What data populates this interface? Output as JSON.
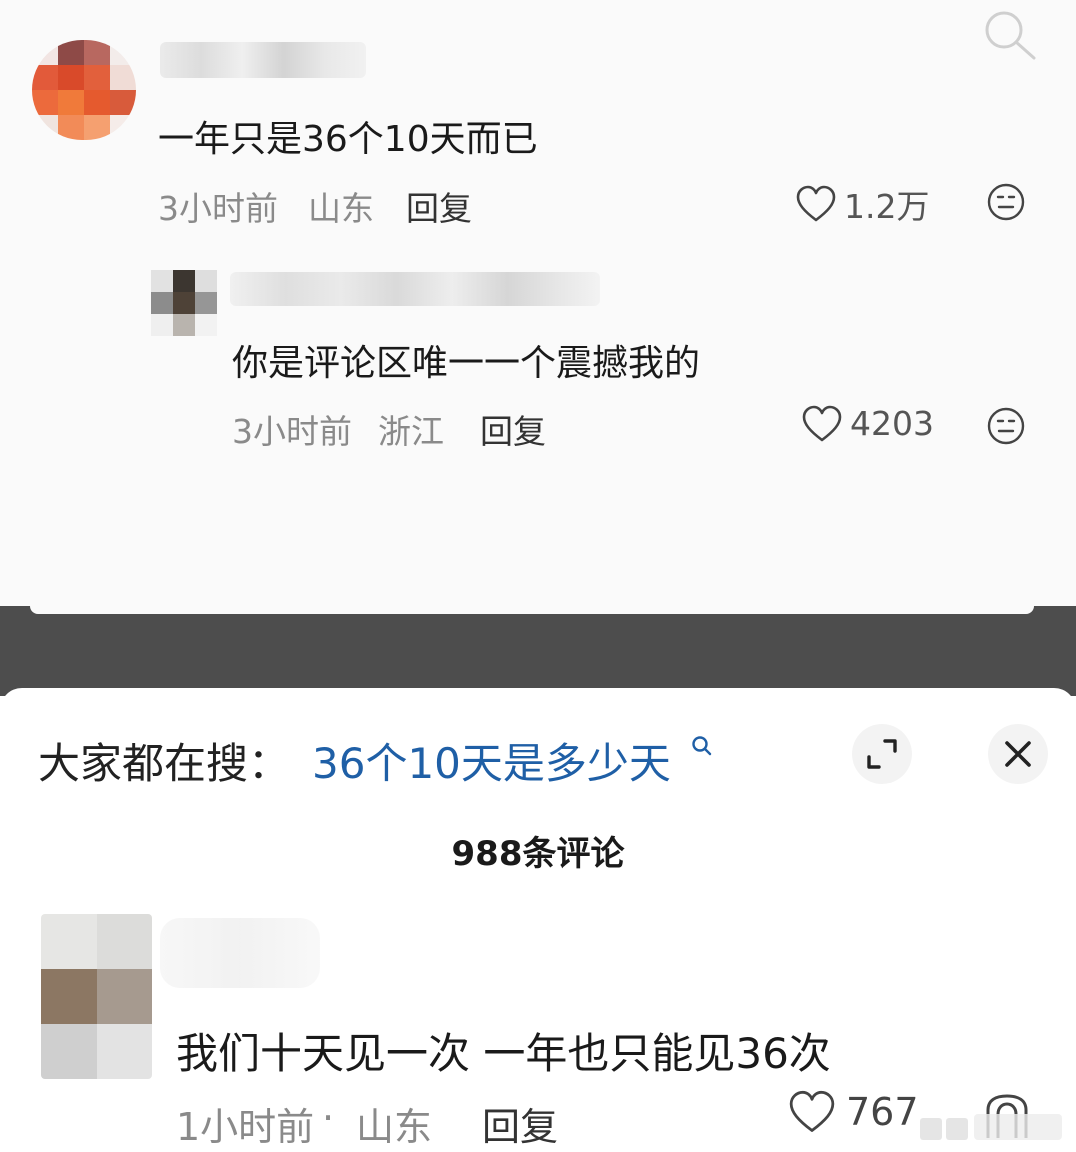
{
  "thread": {
    "comment": {
      "text": "一年只是36个10天而已",
      "time": "3小时前",
      "location": "山东",
      "reply_label": "回复",
      "likes": "1.2万"
    },
    "sub_reply": {
      "text": "你是评论区唯一一个震撼我的",
      "time": "3小时前",
      "location": "浙江",
      "reply_label": "回复",
      "likes": "4203"
    }
  },
  "panel": {
    "search_label": "大家都在搜：",
    "search_query": "36个10天是多少天",
    "comment_count": "988条评论",
    "comment": {
      "text": "我们十天见一次 一年也只能见36次",
      "time": "1小时前",
      "separator": "·",
      "location": "山东",
      "reply_label": "回复",
      "likes": "767"
    }
  },
  "colors": {
    "link_blue": "#1f5fa6",
    "separator_gray": "#4d4d4d",
    "meta_gray": "#8a8a8a"
  },
  "icons": [
    "search-icon",
    "heart-icon",
    "emoji-icon",
    "expand-icon",
    "close-icon",
    "search-small-icon"
  ]
}
